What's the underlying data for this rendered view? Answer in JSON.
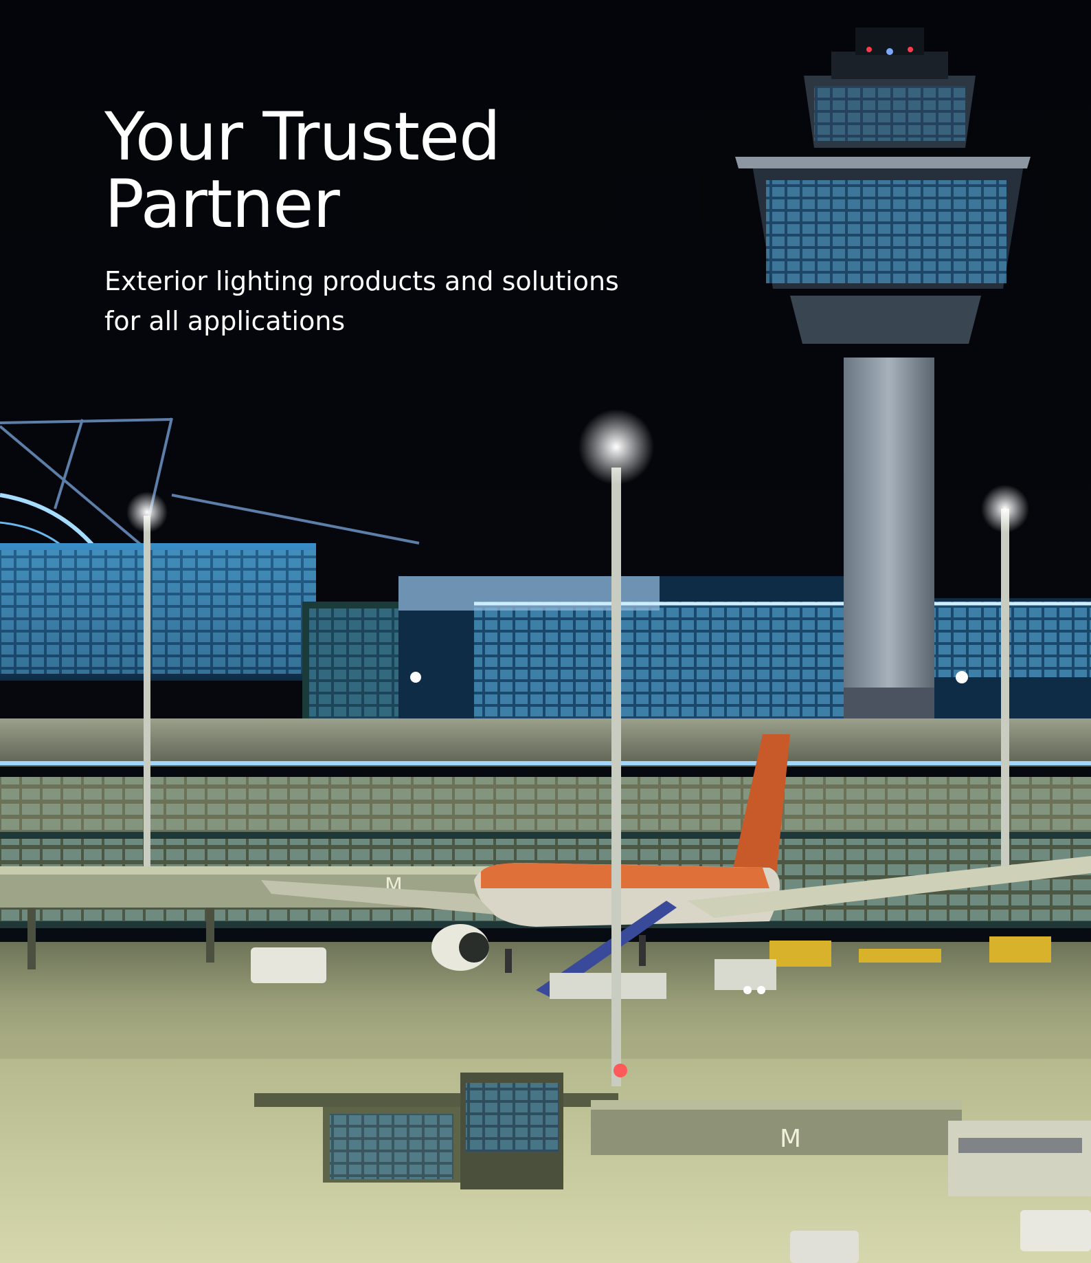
{
  "hero": {
    "headline_line1": "Your Trusted",
    "headline_line2": "Partner",
    "subline_line1": "Exterior lighting products and solutions",
    "subline_line2": "for all applications"
  },
  "colors": {
    "sky": "#05060a",
    "text": "#ffffff",
    "apron": "#b8bb90",
    "facade_light": "#7fd6ff",
    "aircraft_orange": "#e0703a"
  },
  "photo": {
    "jetbridge_letter": "M"
  }
}
